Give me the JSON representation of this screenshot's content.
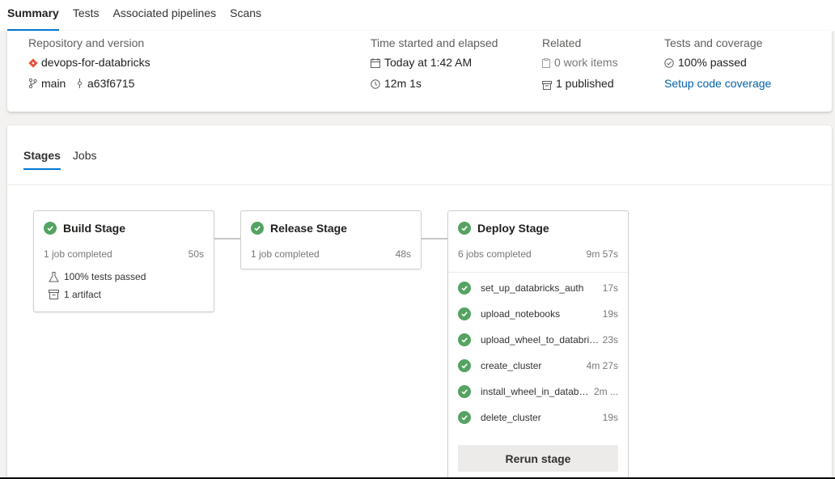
{
  "tabs": [
    "Summary",
    "Tests",
    "Associated pipelines",
    "Scans"
  ],
  "summary": {
    "repo": {
      "header": "Repository and version",
      "name": "devops-for-databricks",
      "branch": "main",
      "commit": "a63f6715"
    },
    "time": {
      "header": "Time started and elapsed",
      "started": "Today at 1:42 AM",
      "elapsed": "12m 1s"
    },
    "related": {
      "header": "Related",
      "work_items": "0 work items",
      "published": "1 published"
    },
    "tests": {
      "header": "Tests and coverage",
      "passed": "100% passed",
      "coverage_link": "Setup code coverage"
    }
  },
  "subtabs": [
    "Stages",
    "Jobs"
  ],
  "stages": [
    {
      "name": "Build Stage",
      "jobs": "1 job completed",
      "duration": "50s",
      "extras": [
        "100% tests passed",
        "1 artifact"
      ]
    },
    {
      "name": "Release Stage",
      "jobs": "1 job completed",
      "duration": "48s"
    },
    {
      "name": "Deploy Stage",
      "jobs": "6 jobs completed",
      "duration": "9m 57s",
      "job_list": [
        {
          "name": "set_up_databricks_auth",
          "duration": "17s"
        },
        {
          "name": "upload_notebooks",
          "duration": "19s"
        },
        {
          "name": "upload_wheel_to_databricks",
          "duration": "23s"
        },
        {
          "name": "create_cluster",
          "duration": "4m 27s"
        },
        {
          "name": "install_wheel_in_databric...",
          "duration": "2m ..."
        },
        {
          "name": "delete_cluster",
          "duration": "19s"
        }
      ],
      "rerun_label": "Rerun stage"
    }
  ],
  "colors": {
    "accent": "#0078d4",
    "success": "#55a362",
    "link": "#0062ad"
  },
  "icons": {
    "repo": "git-diamond-icon",
    "branch": "branch-icon",
    "commit": "commit-icon",
    "calendar": "calendar-icon",
    "clock": "clock-icon",
    "work-item": "clipboard-icon",
    "artifact": "artifact-icon",
    "check": "check-circle-icon",
    "flask": "flask-icon"
  }
}
